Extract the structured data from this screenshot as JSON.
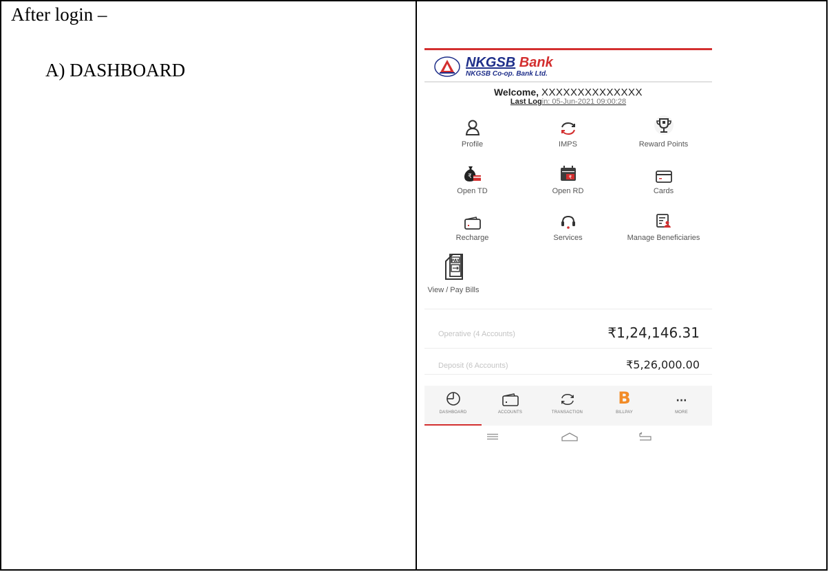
{
  "document": {
    "heading": "After login –",
    "section": "A) DASHBOARD"
  },
  "app": {
    "brand_name": "NKGSB Bank",
    "brand_name_part1": "NKGSB",
    "brand_name_part2": "Bank",
    "brand_sub": "NKGSB Co-op. Bank Ltd.",
    "welcome_prefix": "Welcome,",
    "user_name": "XXXXXXXXXXXXXX",
    "last_login_prefix": "Last Log",
    "last_login_value": "in: 05-Jun-2021 09:00:28",
    "accent_color": "#d32f2f",
    "brand_blue": "#1f2f8a"
  },
  "tiles": [
    {
      "label": "Profile",
      "icon": "person-icon"
    },
    {
      "label": "IMPS",
      "icon": "transfer-arrows-icon"
    },
    {
      "label": "Reward Points",
      "icon": "trophy-icon"
    },
    {
      "label": "Open TD",
      "icon": "money-bag-icon"
    },
    {
      "label": "Open RD",
      "icon": "calendar-icon"
    },
    {
      "label": "Cards",
      "icon": "card-icon"
    },
    {
      "label": "Recharge",
      "icon": "wallet-icon"
    },
    {
      "label": "Services",
      "icon": "headset-icon"
    },
    {
      "label": "Manage Beneficiaries",
      "icon": "beneficiary-doc-icon"
    },
    {
      "label": "View / Pay Bills",
      "icon": "pay-bill-icon"
    }
  ],
  "accounts": [
    {
      "label": "Operative (4 Accounts)",
      "amount": "₹1,24,146.31"
    },
    {
      "label": "Deposit (6 Accounts)",
      "amount": "₹5,26,000.00"
    }
  ],
  "bottom_nav": [
    {
      "label": "DASHBOARD",
      "icon": "pie-chart-icon",
      "active": true
    },
    {
      "label": "ACCOUNTS",
      "icon": "wallet-icon"
    },
    {
      "label": "TRANSACTION",
      "icon": "transfer-arrows-icon"
    },
    {
      "label": "BILLPAY",
      "icon": "billpay-b-icon",
      "glyph": "B"
    },
    {
      "label": "MORE",
      "icon": "more-dots-icon",
      "glyph": "···"
    }
  ]
}
